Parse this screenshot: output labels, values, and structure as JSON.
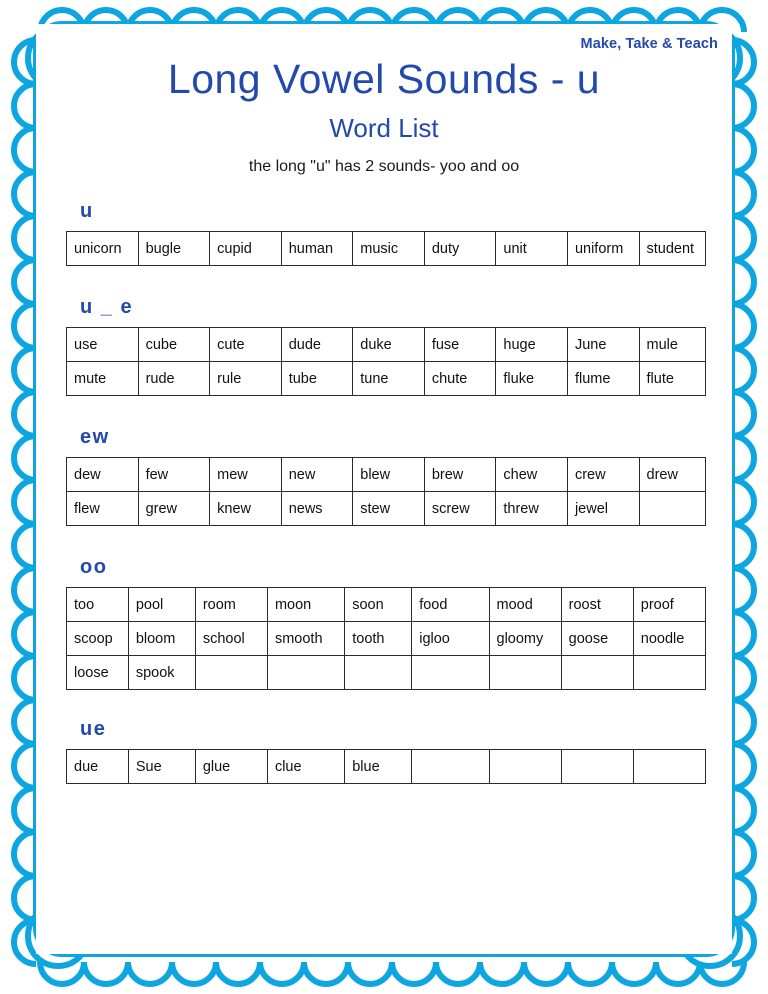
{
  "brand": "Make, Take & Teach",
  "header": {
    "title": "Long Vowel Sounds -  u",
    "subtitle": "Word List",
    "note": "the long \"u\" has 2 sounds- yoo and oo"
  },
  "colors": {
    "border_blue": "#0eа6e0",
    "title_blue": "#2349ac",
    "text_black": "#111111",
    "cell_border": "#2b2b2b"
  },
  "sections": [
    {
      "id": "u",
      "label": "u",
      "columns": 9,
      "col_widths": [
        "11.2%",
        "11.2%",
        "11.2%",
        "11.2%",
        "11.2%",
        "11.2%",
        "11.2%",
        "11.2%",
        "10.4%"
      ],
      "rows": [
        [
          "unicorn",
          "bugle",
          "cupid",
          "human",
          "music",
          "duty",
          "unit",
          "uniform",
          "student"
        ]
      ]
    },
    {
      "id": "u_e",
      "label": "u _ e",
      "columns": 9,
      "col_widths": [
        "11.2%",
        "11.2%",
        "11.2%",
        "11.2%",
        "11.2%",
        "11.2%",
        "11.2%",
        "11.2%",
        "10.4%"
      ],
      "rows": [
        [
          "use",
          "cube",
          "cute",
          "dude",
          "duke",
          "fuse",
          "huge",
          "June",
          "mule"
        ],
        [
          "mute",
          "rude",
          "rule",
          "tube",
          "tune",
          "chute",
          "fluke",
          "flume",
          "flute"
        ]
      ]
    },
    {
      "id": "ew",
      "label": "ew",
      "columns": 9,
      "col_widths": [
        "11.2%",
        "11.2%",
        "11.2%",
        "11.2%",
        "11.2%",
        "11.2%",
        "11.2%",
        "11.2%",
        "10.4%"
      ],
      "rows": [
        [
          "dew",
          "few",
          "mew",
          "new",
          "blew",
          "brew",
          "chew",
          "crew",
          "drew"
        ],
        [
          "flew",
          "grew",
          "knew",
          "news",
          "stew",
          "screw",
          "threw",
          "jewel",
          ""
        ]
      ]
    },
    {
      "id": "oo",
      "label": "oo",
      "columns": 9,
      "col_widths": [
        "9.6%",
        "10.4%",
        "11.2%",
        "12.0%",
        "10.4%",
        "12.0%",
        "11.2%",
        "11.2%",
        "11.2%"
      ],
      "rows": [
        [
          "too",
          "pool",
          "room",
          "moon",
          "soon",
          "food",
          "mood",
          "roost",
          "proof"
        ],
        [
          "scoop",
          "bloom",
          "school",
          "smooth",
          "tooth",
          "igloo",
          "gloomy",
          "goose",
          "noodle"
        ],
        [
          "loose",
          "spook",
          "",
          "",
          "",
          "",
          "",
          "",
          ""
        ]
      ]
    },
    {
      "id": "ue",
      "label": "ue",
      "columns": 9,
      "col_widths": [
        "9.6%",
        "10.4%",
        "11.2%",
        "12.0%",
        "10.4%",
        "12.0%",
        "11.2%",
        "11.2%",
        "11.2%"
      ],
      "rows": [
        [
          "due",
          "Sue",
          "glue",
          "clue",
          "blue",
          "",
          "",
          "",
          ""
        ]
      ]
    }
  ]
}
